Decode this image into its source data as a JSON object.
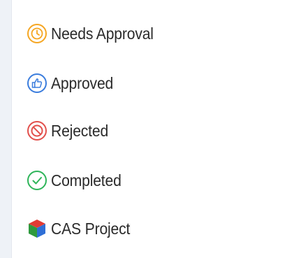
{
  "legend": {
    "items": [
      {
        "label": "Needs Approval",
        "icon": "clock-icon",
        "color": "#f5a623"
      },
      {
        "label": "Approved",
        "icon": "thumbs-up-icon",
        "color": "#3b7ddd"
      },
      {
        "label": "Rejected",
        "icon": "prohibited-icon",
        "color": "#e2504c"
      },
      {
        "label": "Completed",
        "icon": "checkmark-icon",
        "color": "#2fb55a"
      },
      {
        "label": "CAS Project",
        "icon": "cube-icon",
        "colors": [
          "#e23b34",
          "#2f9a3e",
          "#2f6fd6"
        ]
      }
    ]
  }
}
